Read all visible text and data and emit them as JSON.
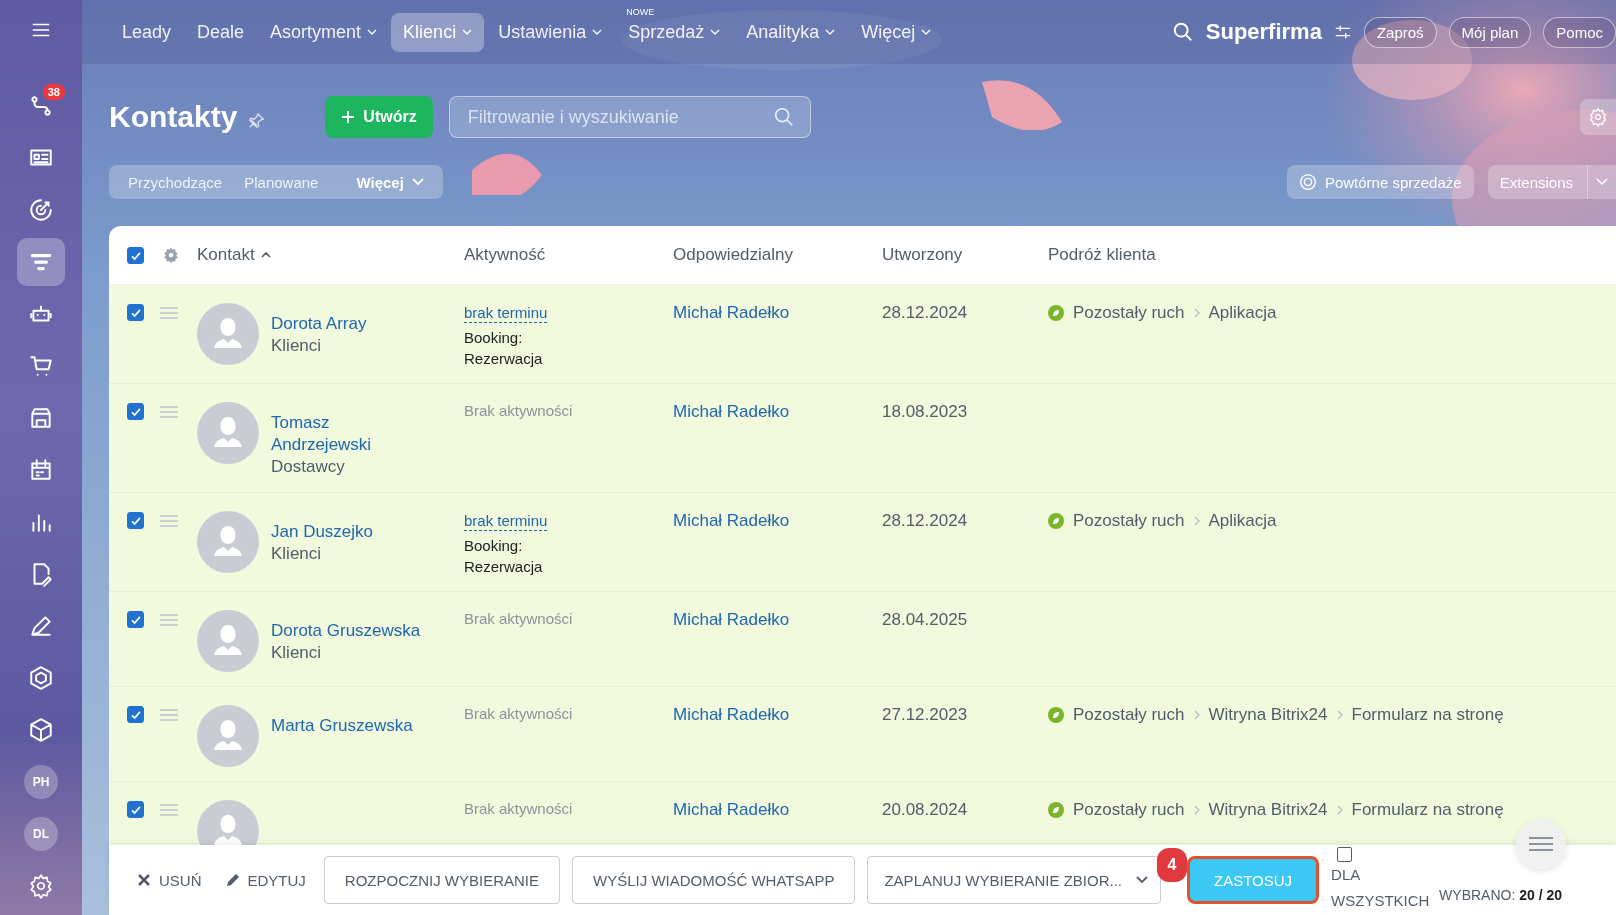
{
  "sidebar": {
    "items": [
      {
        "kind": "icon",
        "badge": "38",
        "selected": false
      },
      {
        "kind": "icon",
        "selected": false
      },
      {
        "kind": "icon",
        "selected": false
      },
      {
        "kind": "icon",
        "selected": true
      },
      {
        "kind": "icon",
        "selected": false
      },
      {
        "kind": "icon",
        "selected": false
      },
      {
        "kind": "icon",
        "selected": false
      },
      {
        "kind": "icon",
        "selected": false
      },
      {
        "kind": "icon",
        "selected": false
      },
      {
        "kind": "icon",
        "selected": false
      },
      {
        "kind": "icon",
        "selected": false
      },
      {
        "kind": "icon",
        "selected": false
      },
      {
        "kind": "icon",
        "selected": false
      },
      {
        "kind": "avatar",
        "initials": "PH",
        "selected": false
      },
      {
        "kind": "avatar",
        "initials": "DL",
        "selected": false
      }
    ]
  },
  "top_nav": {
    "items": [
      {
        "label": "Leady",
        "selected": false,
        "dropdown": false
      },
      {
        "label": "Deale",
        "selected": false,
        "dropdown": false
      },
      {
        "label": "Asortyment",
        "selected": false,
        "dropdown": true
      },
      {
        "label": "Klienci",
        "selected": true,
        "dropdown": true
      },
      {
        "label": "Ustawienia",
        "selected": false,
        "dropdown": true
      },
      {
        "label": "Sprzedaż",
        "selected": false,
        "dropdown": true,
        "badge": "NOWE"
      },
      {
        "label": "Analityka",
        "selected": false,
        "dropdown": true
      },
      {
        "label": "Więcej",
        "selected": false,
        "dropdown": true
      }
    ],
    "company": "Superfirma",
    "buttons": [
      "Zaproś",
      "Mój plan",
      "Pomoc"
    ]
  },
  "page": {
    "title": "Kontakty",
    "create_button": "Utwórz",
    "search": {
      "placeholder": "Filtrowanie i wyszukiwanie"
    }
  },
  "filters": [
    {
      "label": "Przychodzące",
      "selected": false,
      "dropdown": false
    },
    {
      "label": "Planowane",
      "selected": false,
      "dropdown": false
    },
    {
      "label": "Więcej",
      "selected": false,
      "dropdown": true
    }
  ],
  "right_actions": {
    "repeat_sales": "Powtórne sprzedaże",
    "extensions": "Extensions"
  },
  "table": {
    "all_checked": true,
    "columns": [
      {
        "label": "Kontakt",
        "sorted": true
      },
      {
        "label": "Aktywność",
        "sorted": false
      },
      {
        "label": "Odpowiedzialny",
        "sorted": false
      },
      {
        "label": "Utworzony",
        "sorted": false
      },
      {
        "label": "Podróż klienta",
        "sorted": false
      }
    ],
    "rows": [
      {
        "checked": true,
        "name": "Dorota Array",
        "type": "Klienci",
        "activity": {
          "kind": "deadline",
          "link": "brak terminu",
          "lines": [
            "Booking:",
            "Rezerwacja"
          ]
        },
        "responsible": "Michał Radełko",
        "created": "28.12.2024",
        "journey": [
          "Pozostały ruch",
          "Aplikacja"
        ]
      },
      {
        "checked": true,
        "name": "Tomasz Andrzejewski",
        "type": "Dostawcy",
        "activity": {
          "kind": "none",
          "text": "Brak aktywności"
        },
        "responsible": "Michał Radełko",
        "created": "18.08.2023",
        "journey": []
      },
      {
        "checked": true,
        "name": "Jan Duszejko",
        "type": "Klienci",
        "activity": {
          "kind": "deadline",
          "link": "brak terminu",
          "lines": [
            "Booking:",
            "Rezerwacja"
          ]
        },
        "responsible": "Michał Radełko",
        "created": "28.12.2024",
        "journey": [
          "Pozostały ruch",
          "Aplikacja"
        ]
      },
      {
        "checked": true,
        "name": "Dorota Gruszewska",
        "type": "Klienci",
        "activity": {
          "kind": "none",
          "text": "Brak aktywności"
        },
        "responsible": "Michał Radełko",
        "created": "28.04.2025",
        "journey": []
      },
      {
        "checked": true,
        "name": "Marta Gruszewska",
        "activity": {
          "kind": "none",
          "text": "Brak aktywności"
        },
        "responsible": "Michał Radełko",
        "created": "27.12.2023",
        "journey": [
          "Pozostały ruch",
          "Witryna Bitrix24",
          "Formularz na stronę"
        ]
      },
      {
        "checked": true,
        "activity": {
          "kind": "none",
          "text": "Brak aktywności"
        },
        "responsible": "Michał Radełko",
        "created": "20.08.2024",
        "journey": [
          "Pozostały ruch",
          "Witryna Bitrix24",
          "Formularz na stronę"
        ]
      }
    ]
  },
  "action_bar": {
    "delete": "USUŃ",
    "edit": "EDYTUJ",
    "buttons": [
      "ROZPOCZNIJ WYBIERANIE",
      "WYŚLIJ WIADOMOŚĆ WHATSAPP"
    ],
    "schedule_select": "ZAPLANUJ WYBIERANIE ZBIOR...",
    "step_badge": "4",
    "apply": "ZASTOSUJ",
    "for_all": {
      "label": "DLA WSZYSTKICH",
      "checked": false
    },
    "selected_label": "WYBRANO:",
    "selected_count": "20 / 20"
  }
}
